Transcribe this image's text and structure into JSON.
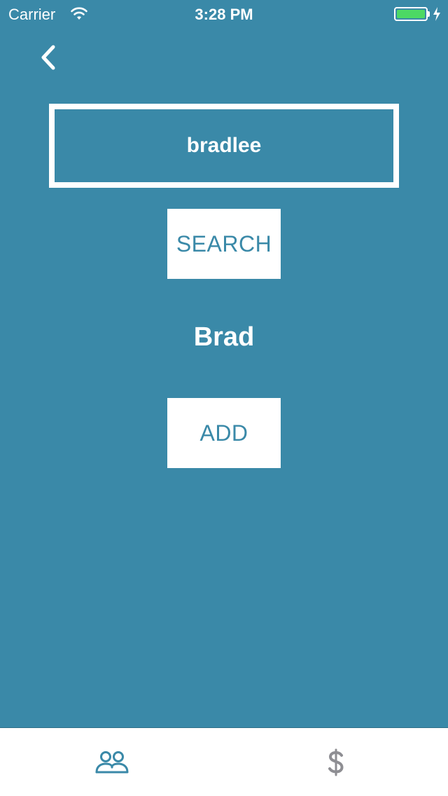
{
  "status_bar": {
    "carrier": "Carrier",
    "time": "3:28 PM",
    "battery_color": "#4cd964"
  },
  "nav": {
    "back_icon": "chevron-left-icon"
  },
  "search": {
    "value": "bradlee",
    "button_label": "SEARCH"
  },
  "result": {
    "name": "Brad",
    "add_label": "ADD"
  },
  "tab_bar": {
    "tabs": [
      {
        "icon": "friends-icon",
        "active": true
      },
      {
        "icon": "dollar-icon",
        "active": false
      }
    ]
  },
  "colors": {
    "background": "#3a89a8",
    "accent": "#3a89a8",
    "inactive_tab": "#8e8e93"
  }
}
